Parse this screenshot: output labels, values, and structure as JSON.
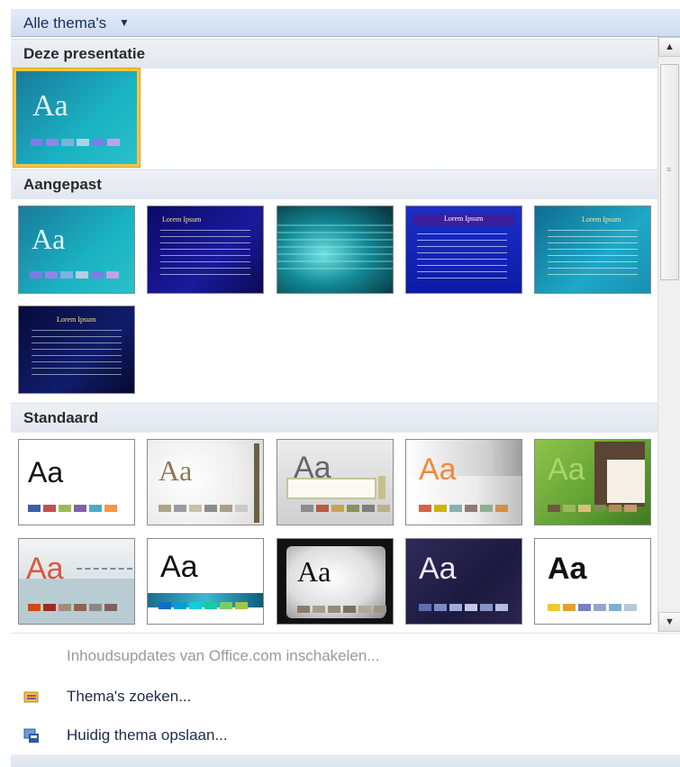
{
  "header": {
    "title": "Alle thema's",
    "caret": "▼"
  },
  "sections": {
    "current": "Deze presentatie",
    "custom": "Aangepast",
    "standard": "Standaard"
  },
  "thumb_text": {
    "aa": "Aa",
    "lorem": "Lorem Ipsum"
  },
  "menu": {
    "updates": "Inhoudsupdates van Office.com inschakelen...",
    "search": "Thema's zoeken...",
    "save": "Huidig thema opslaan..."
  },
  "scrollbar": {
    "up": "▲",
    "down": "▼"
  },
  "colors": {
    "accent": "#f5c542",
    "header_bg": "#d8e4f3",
    "teal": "#1a9fb3"
  }
}
